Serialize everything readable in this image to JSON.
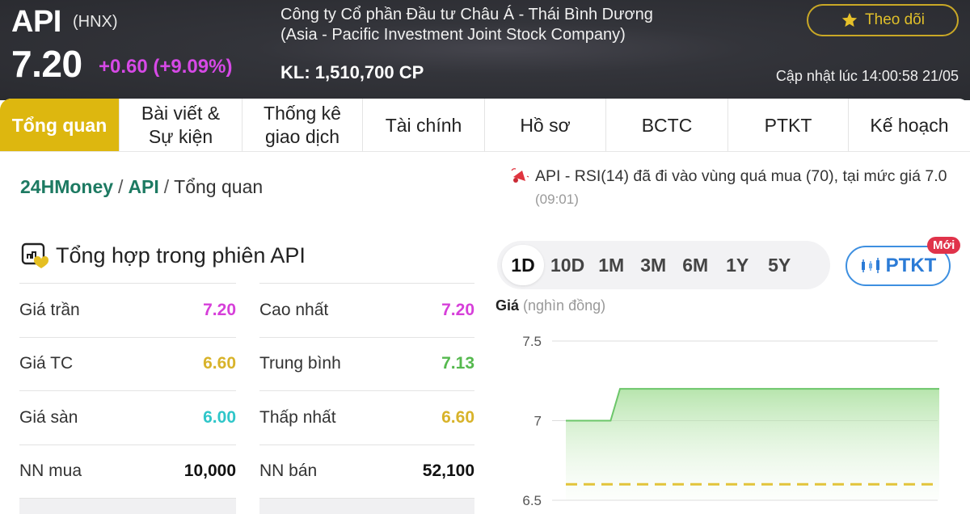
{
  "header": {
    "ticker": "API",
    "exchange": "(HNX)",
    "price": "7.20",
    "change": "+0.60 (+9.09%)",
    "company_vi": "Công ty Cổ phần Đầu tư Châu Á - Thái Bình Dương",
    "company_en": "(Asia - Pacific Investment Joint Stock Company)",
    "volume": "KL: 1,510,700 CP",
    "follow_label": "Theo dõi",
    "updated": "Cập nhật lúc 14:00:58 21/05"
  },
  "tabs": [
    {
      "label": "Tổng quan",
      "active": true
    },
    {
      "label": "Bài viết & Sự kiện"
    },
    {
      "label": "Thống kê giao dịch"
    },
    {
      "label": "Tài chính"
    },
    {
      "label": "Hồ sơ"
    },
    {
      "label": "BCTC"
    },
    {
      "label": "PTKT"
    },
    {
      "label": "Kế hoạch"
    }
  ],
  "breadcrumb": {
    "home": "24HMoney",
    "ticker": "API",
    "current": "Tổng quan",
    "separator": "/"
  },
  "alert": {
    "text": "API - RSI(14) đã đi vào vùng quá mua (70), tại mức giá 7.0",
    "time": "(09:01)"
  },
  "summary": {
    "title": "Tổng hợp trong phiên API",
    "left": [
      {
        "label": "Giá trần",
        "value": "7.20",
        "color": "#d63fd9"
      },
      {
        "label": "Giá TC",
        "value": "6.60",
        "color": "#d8b32a"
      },
      {
        "label": "Giá sàn",
        "value": "6.00",
        "color": "#2fc6c9"
      },
      {
        "label": "NN mua",
        "value": "10,000",
        "color": "#111111"
      }
    ],
    "right": [
      {
        "label": "Cao nhất",
        "value": "7.20",
        "color": "#d63fd9"
      },
      {
        "label": "Trung bình",
        "value": "7.13",
        "color": "#55b94e"
      },
      {
        "label": "Thấp nhất",
        "value": "6.60",
        "color": "#d8b32a"
      },
      {
        "label": "NN bán",
        "value": "52,100",
        "color": "#111111"
      }
    ]
  },
  "periods": [
    "1D",
    "10D",
    "1M",
    "3M",
    "6M",
    "1Y",
    "5Y"
  ],
  "active_period": "1D",
  "ptkt_button": {
    "label": "PTKT",
    "badge": "Mới"
  },
  "chart_label": {
    "bold": "Giá",
    "unit": "(nghìn đồng)"
  },
  "chart_data": {
    "type": "area",
    "title": "",
    "ylabel": "Giá (nghìn đồng)",
    "ylim": [
      6.5,
      7.5
    ],
    "yticks": [
      "7.5",
      "7",
      "6.5"
    ],
    "grid": true,
    "x": [
      0,
      0.12,
      0.145,
      1.0
    ],
    "values": [
      7.0,
      7.0,
      7.2,
      7.2
    ],
    "reference_line": {
      "value": 6.6,
      "style": "dashed",
      "color": "#e2c43a"
    },
    "line_color": "#6cc66a"
  }
}
